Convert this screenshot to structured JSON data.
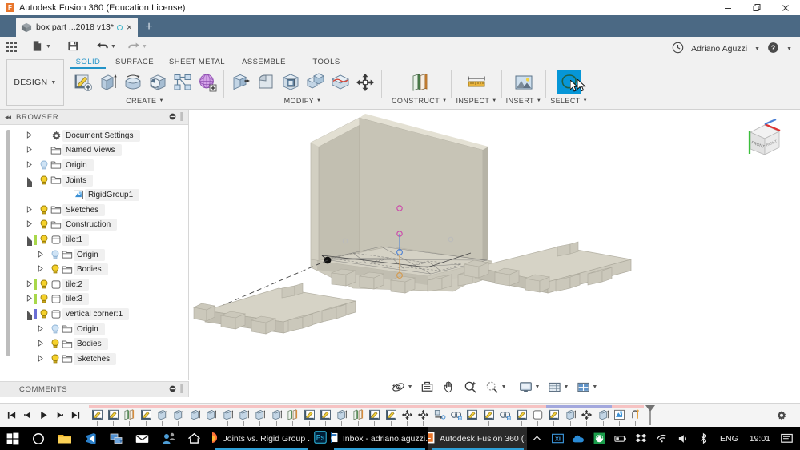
{
  "window": {
    "title": "Autodesk Fusion 360 (Education License)",
    "app_icon": "F",
    "minimize": "minimize-icon",
    "maximize": "restore-icon",
    "close": "close-icon"
  },
  "doc_tab": {
    "label": "box part ...2018 v13*",
    "cube_icon": "cube-icon",
    "saving_indicator": "circle-icon",
    "close": "×",
    "new_tab": "+"
  },
  "quick_access": {
    "items": [
      {
        "name": "app-grid-icon",
        "label": "",
        "caret": false
      },
      {
        "name": "new-file-icon",
        "label": "",
        "caret": true
      },
      {
        "name": "save-icon",
        "label": "",
        "caret": false
      },
      {
        "name": "undo-icon",
        "label": "",
        "caret": true
      },
      {
        "name": "redo-icon",
        "label": "",
        "caret": true
      }
    ]
  },
  "ribbon": {
    "workspace": "DESIGN",
    "workspace_caret": "▾",
    "tabs": [
      {
        "label": "SOLID",
        "active": true
      },
      {
        "label": "SURFACE",
        "active": false
      },
      {
        "label": "SHEET METAL",
        "active": false
      },
      {
        "label": "ASSEMBLE",
        "active": false
      },
      {
        "label": "TOOLS",
        "active": false
      }
    ],
    "groups": [
      {
        "label": "CREATE",
        "caret": "▾",
        "tools": [
          {
            "name": "create-sketch-icon",
            "selected": false
          },
          {
            "name": "extrude-icon",
            "selected": false
          },
          {
            "name": "revolve-icon",
            "selected": false
          },
          {
            "name": "sweep-icon",
            "selected": false
          },
          {
            "name": "pattern-icon",
            "selected": false
          },
          {
            "name": "create-form-icon",
            "selected": false
          }
        ]
      },
      {
        "label": "MODIFY",
        "caret": "▾",
        "tools": [
          {
            "name": "press-pull-icon",
            "selected": false
          },
          {
            "name": "fillet-icon",
            "selected": false
          },
          {
            "name": "shell-icon",
            "selected": false
          },
          {
            "name": "combine-icon",
            "selected": false
          },
          {
            "name": "split-face-icon",
            "selected": false
          },
          {
            "name": "move-copy-icon",
            "selected": false
          }
        ]
      },
      {
        "label": "CONSTRUCT",
        "caret": "▾",
        "tools": [
          {
            "name": "construct-plane-icon",
            "selected": false
          }
        ]
      },
      {
        "label": "INSPECT",
        "caret": "▾",
        "tools": [
          {
            "name": "measure-icon",
            "selected": false
          }
        ]
      },
      {
        "label": "INSERT",
        "caret": "▾",
        "tools": [
          {
            "name": "insert-image-icon",
            "selected": false
          }
        ]
      },
      {
        "label": "SELECT",
        "caret": "▾",
        "tools": [
          {
            "name": "select-lasso-icon",
            "selected": true
          }
        ]
      }
    ]
  },
  "account": {
    "recent_icon": "clock-icon",
    "user_name": "Adriano Aguzzi",
    "user_caret": "▾",
    "help_icon": "help-icon",
    "help_caret": "▾"
  },
  "browser": {
    "title": "BROWSER",
    "collapse_icon": "collapse-left-icon",
    "dot_icon": "panel-dot-icon",
    "grip_icon": "panel-grip-icon",
    "nodes": [
      {
        "label": "Document Settings",
        "indent": 1,
        "twisty": "closed",
        "bulb": false,
        "folder": "gear",
        "bar": "none"
      },
      {
        "label": "Named Views",
        "indent": 1,
        "twisty": "closed",
        "bulb": false,
        "folder": "folder",
        "bar": "none"
      },
      {
        "label": "Origin",
        "indent": 1,
        "twisty": "closed",
        "bulb": "dim",
        "folder": "folder",
        "bar": "none"
      },
      {
        "label": "Joints",
        "indent": 1,
        "twisty": "open",
        "bulb": "on",
        "folder": "folder",
        "bar": "none"
      },
      {
        "label": "RigidGroup1",
        "indent": 3,
        "twisty": "none",
        "bulb": false,
        "folder": "rigidgroup",
        "bar": "none"
      },
      {
        "label": "Sketches",
        "indent": 1,
        "twisty": "closed",
        "bulb": "on",
        "folder": "folder",
        "bar": "none"
      },
      {
        "label": "Construction",
        "indent": 1,
        "twisty": "closed",
        "bulb": "on",
        "folder": "folder",
        "bar": "none"
      },
      {
        "label": "tile:1",
        "indent": 1,
        "twisty": "open",
        "bulb": "on",
        "folder": "component",
        "bar": "green"
      },
      {
        "label": "Origin",
        "indent": 2,
        "twisty": "closed",
        "bulb": "dim",
        "folder": "folder",
        "bar": "none"
      },
      {
        "label": "Bodies",
        "indent": 2,
        "twisty": "closed",
        "bulb": "on",
        "folder": "folder",
        "bar": "none"
      },
      {
        "label": "tile:2",
        "indent": 1,
        "twisty": "closed",
        "bulb": "on",
        "folder": "component",
        "bar": "green"
      },
      {
        "label": "tile:3",
        "indent": 1,
        "twisty": "closed",
        "bulb": "on",
        "folder": "component",
        "bar": "green"
      },
      {
        "label": "vertical corner:1",
        "indent": 1,
        "twisty": "open",
        "bulb": "on",
        "folder": "component",
        "bar": "blue"
      },
      {
        "label": "Origin",
        "indent": 2,
        "twisty": "closed",
        "bulb": "dim",
        "folder": "folder",
        "bar": "none"
      },
      {
        "label": "Bodies",
        "indent": 2,
        "twisty": "closed",
        "bulb": "on",
        "folder": "folder",
        "bar": "none"
      },
      {
        "label": "Sketches",
        "indent": 2,
        "twisty": "closed",
        "bulb": "on",
        "folder": "folder",
        "bar": "none"
      }
    ]
  },
  "comments": {
    "title": "COMMENTS",
    "dot_icon": "panel-dot-icon",
    "grip_icon": "panel-grip-icon"
  },
  "canvas": {
    "background": "#ffffff",
    "model_color": "#cdcabd",
    "viewcube": {
      "name": "view-cube",
      "front_face": "FRONT",
      "top_face": "TOP",
      "right_face": "RIGHT",
      "axis_x_color": "#e03030",
      "axis_y_color": "#3cbf3c",
      "axis_z_color": "#4a7fd4"
    }
  },
  "navbar": {
    "items": [
      {
        "name": "orbit-icon",
        "caret": true
      },
      {
        "name": "look-at-icon",
        "caret": false
      },
      {
        "name": "pan-icon",
        "caret": false
      },
      {
        "name": "zoom-icon",
        "caret": false
      },
      {
        "name": "zoom-window-icon",
        "caret": true
      },
      {
        "name": "display-settings-icon",
        "caret": true
      },
      {
        "name": "grid-snaps-icon",
        "caret": true
      },
      {
        "name": "viewports-icon",
        "caret": true
      }
    ]
  },
  "timeline": {
    "nav": [
      {
        "name": "go-to-beginning-icon"
      },
      {
        "name": "step-back-icon"
      },
      {
        "name": "play-icon"
      },
      {
        "name": "step-forward-icon"
      },
      {
        "name": "go-to-end-icon"
      }
    ],
    "band_colors": {
      "sketch_group": "#f6c3c3",
      "selected_group": "#a3a8dd"
    },
    "features": [
      {
        "name": "sketch-feature",
        "icon": "sketch",
        "band": "sketch_group"
      },
      {
        "name": "sketch-feature",
        "icon": "sketch",
        "band": "sketch_group"
      },
      {
        "name": "construct-plane-feature",
        "icon": "plane",
        "band": "sketch_group"
      },
      {
        "name": "sketch-feature",
        "icon": "sketch",
        "band": "sketch_group"
      },
      {
        "name": "extrude-feature",
        "icon": "extrude",
        "band": "sketch_group"
      },
      {
        "name": "extrude-feature",
        "icon": "extrude",
        "band": "sketch_group"
      },
      {
        "name": "extrude-feature",
        "icon": "extrude",
        "band": "sketch_group"
      },
      {
        "name": "extrude-feature",
        "icon": "extrude",
        "band": "sketch_group"
      },
      {
        "name": "extrude-feature",
        "icon": "extrude",
        "band": "sketch_group"
      },
      {
        "name": "extrude-feature",
        "icon": "extrude",
        "band": "sketch_group"
      },
      {
        "name": "extrude-feature",
        "icon": "extrude",
        "band": "sketch_group"
      },
      {
        "name": "extrude-feature",
        "icon": "extrude",
        "band": "sketch_group"
      },
      {
        "name": "construct-plane-feature",
        "icon": "plane",
        "band": "sketch_group"
      },
      {
        "name": "sketch-feature",
        "icon": "sketch",
        "band": "sketch_group"
      },
      {
        "name": "sketch-feature",
        "icon": "sketch",
        "band": "sketch_group"
      },
      {
        "name": "extrude-feature",
        "icon": "extrude",
        "band": "sketch_group"
      },
      {
        "name": "construct-plane-feature",
        "icon": "plane",
        "band": "sketch_group"
      },
      {
        "name": "sketch-feature",
        "icon": "sketch",
        "band": "sketch_group"
      },
      {
        "name": "sketch-feature",
        "icon": "sketch",
        "band": "sketch_group"
      },
      {
        "name": "move-feature",
        "icon": "move",
        "band": "sketch_group"
      },
      {
        "name": "move-feature",
        "icon": "move",
        "band": "sketch_group"
      },
      {
        "name": "align-feature",
        "icon": "align",
        "band": "sketch_group"
      },
      {
        "name": "joint-feature",
        "icon": "joint",
        "band": "sketch_group"
      },
      {
        "name": "sketch-feature",
        "icon": "sketch",
        "band": "sketch_group"
      },
      {
        "name": "sketch-feature",
        "icon": "sketch",
        "band": "sketch_group"
      },
      {
        "name": "joint-feature",
        "icon": "joint",
        "band": "sketch_group"
      },
      {
        "name": "sketch-feature",
        "icon": "sketch",
        "band": "sketch_group"
      },
      {
        "name": "component-feature",
        "icon": "component",
        "band": "sketch_group"
      },
      {
        "name": "sketch-feature",
        "icon": "sketch",
        "band": "selected_group"
      },
      {
        "name": "extrude-feature",
        "icon": "extrude",
        "band": "selected_group"
      },
      {
        "name": "move-feature",
        "icon": "move",
        "band": "selected_group"
      },
      {
        "name": "extrude-feature",
        "icon": "extrude",
        "band": "selected_group"
      },
      {
        "name": "rigid-group-feature",
        "icon": "rigidgroup",
        "band": "sketch_group"
      },
      {
        "name": "joint-origin-feature",
        "icon": "jointorigin",
        "band": "sketch_group"
      }
    ],
    "settings_icon": "settings-gear-icon"
  },
  "taskbar": {
    "start": "windows-start-icon",
    "pinned": [
      {
        "name": "cortana-search-icon"
      },
      {
        "name": "file-explorer-icon"
      },
      {
        "name": "vscode-icon"
      },
      {
        "name": "network-app-icon"
      },
      {
        "name": "mail-icon"
      },
      {
        "name": "user-share-icon"
      },
      {
        "name": "home-icon"
      }
    ],
    "apps": [
      {
        "name": "firefox-window",
        "icon": "firefox-icon",
        "label": "Joints vs. Rigid Group ...",
        "running": true,
        "active": false
      },
      {
        "name": "photoshop-window",
        "icon": "photoshop-icon",
        "label": "",
        "running": false,
        "active": false
      },
      {
        "name": "outlook-window",
        "icon": "outlook-icon",
        "label": "Inbox - adriano.aguzzi...",
        "running": true,
        "active": false
      },
      {
        "name": "fusion-window",
        "icon": "fusion-icon",
        "label": "Autodesk Fusion 360 (...",
        "running": true,
        "active": true
      }
    ],
    "tray": [
      {
        "name": "show-hidden-icons-chevron"
      },
      {
        "name": "ms-teams-tray-icon"
      },
      {
        "name": "onedrive-tray-icon"
      },
      {
        "name": "fusion-tray-icon"
      },
      {
        "name": "battery-tray-icon"
      },
      {
        "name": "dropbox-tray-icon"
      },
      {
        "name": "wifi-tray-icon"
      },
      {
        "name": "volume-tray-icon"
      },
      {
        "name": "bluetooth-tray-icon"
      }
    ],
    "language": "ENG",
    "clock": "19:01",
    "notifications": "action-center-icon"
  }
}
